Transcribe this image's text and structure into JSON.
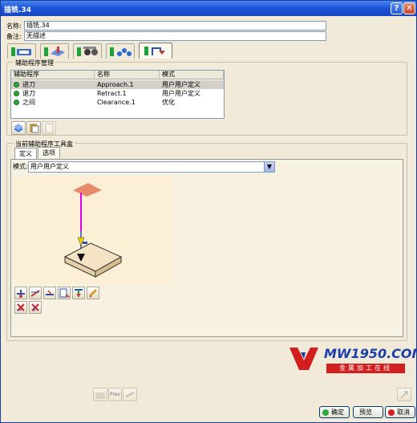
{
  "window": {
    "title": "插铣.34"
  },
  "form": {
    "name_label": "名称:",
    "name_value": "插铣.34",
    "comment_label": "备注:",
    "comment_value": "无描述"
  },
  "macro_management": {
    "title": "辅助程序管理",
    "columns": [
      "辅助程序",
      "名称",
      "模式"
    ],
    "rows": [
      {
        "program": "进刀",
        "name": "Approach.1",
        "mode": "用户用户定义",
        "selected": true
      },
      {
        "program": "退刀",
        "name": "Retract.1",
        "mode": "用户用户定义",
        "selected": false
      },
      {
        "program": "之间",
        "name": "Clearance.1",
        "mode": "优化",
        "selected": false
      }
    ]
  },
  "toolbox": {
    "title": "当前辅助程序工具盒",
    "tabs": [
      "定义",
      "选项"
    ],
    "mode_label": "模式:",
    "mode_value": "用户用户定义"
  },
  "logo": {
    "text": "MW1950.COM",
    "subtext": "金属加工在线"
  },
  "footer": {
    "ok": "确定",
    "preview": "预览",
    "cancel": "取消",
    "disabled_label": "Prev"
  },
  "colors": {
    "titlebar": "#1e55d8",
    "dialog_bg": "#f2ead8",
    "preview_bg": "#fbefd6",
    "path_magenta": "#e000e0",
    "approach_plane": "#e88a6a",
    "logo_red": "#d11f1f",
    "logo_blue": "#1a3fa8"
  }
}
